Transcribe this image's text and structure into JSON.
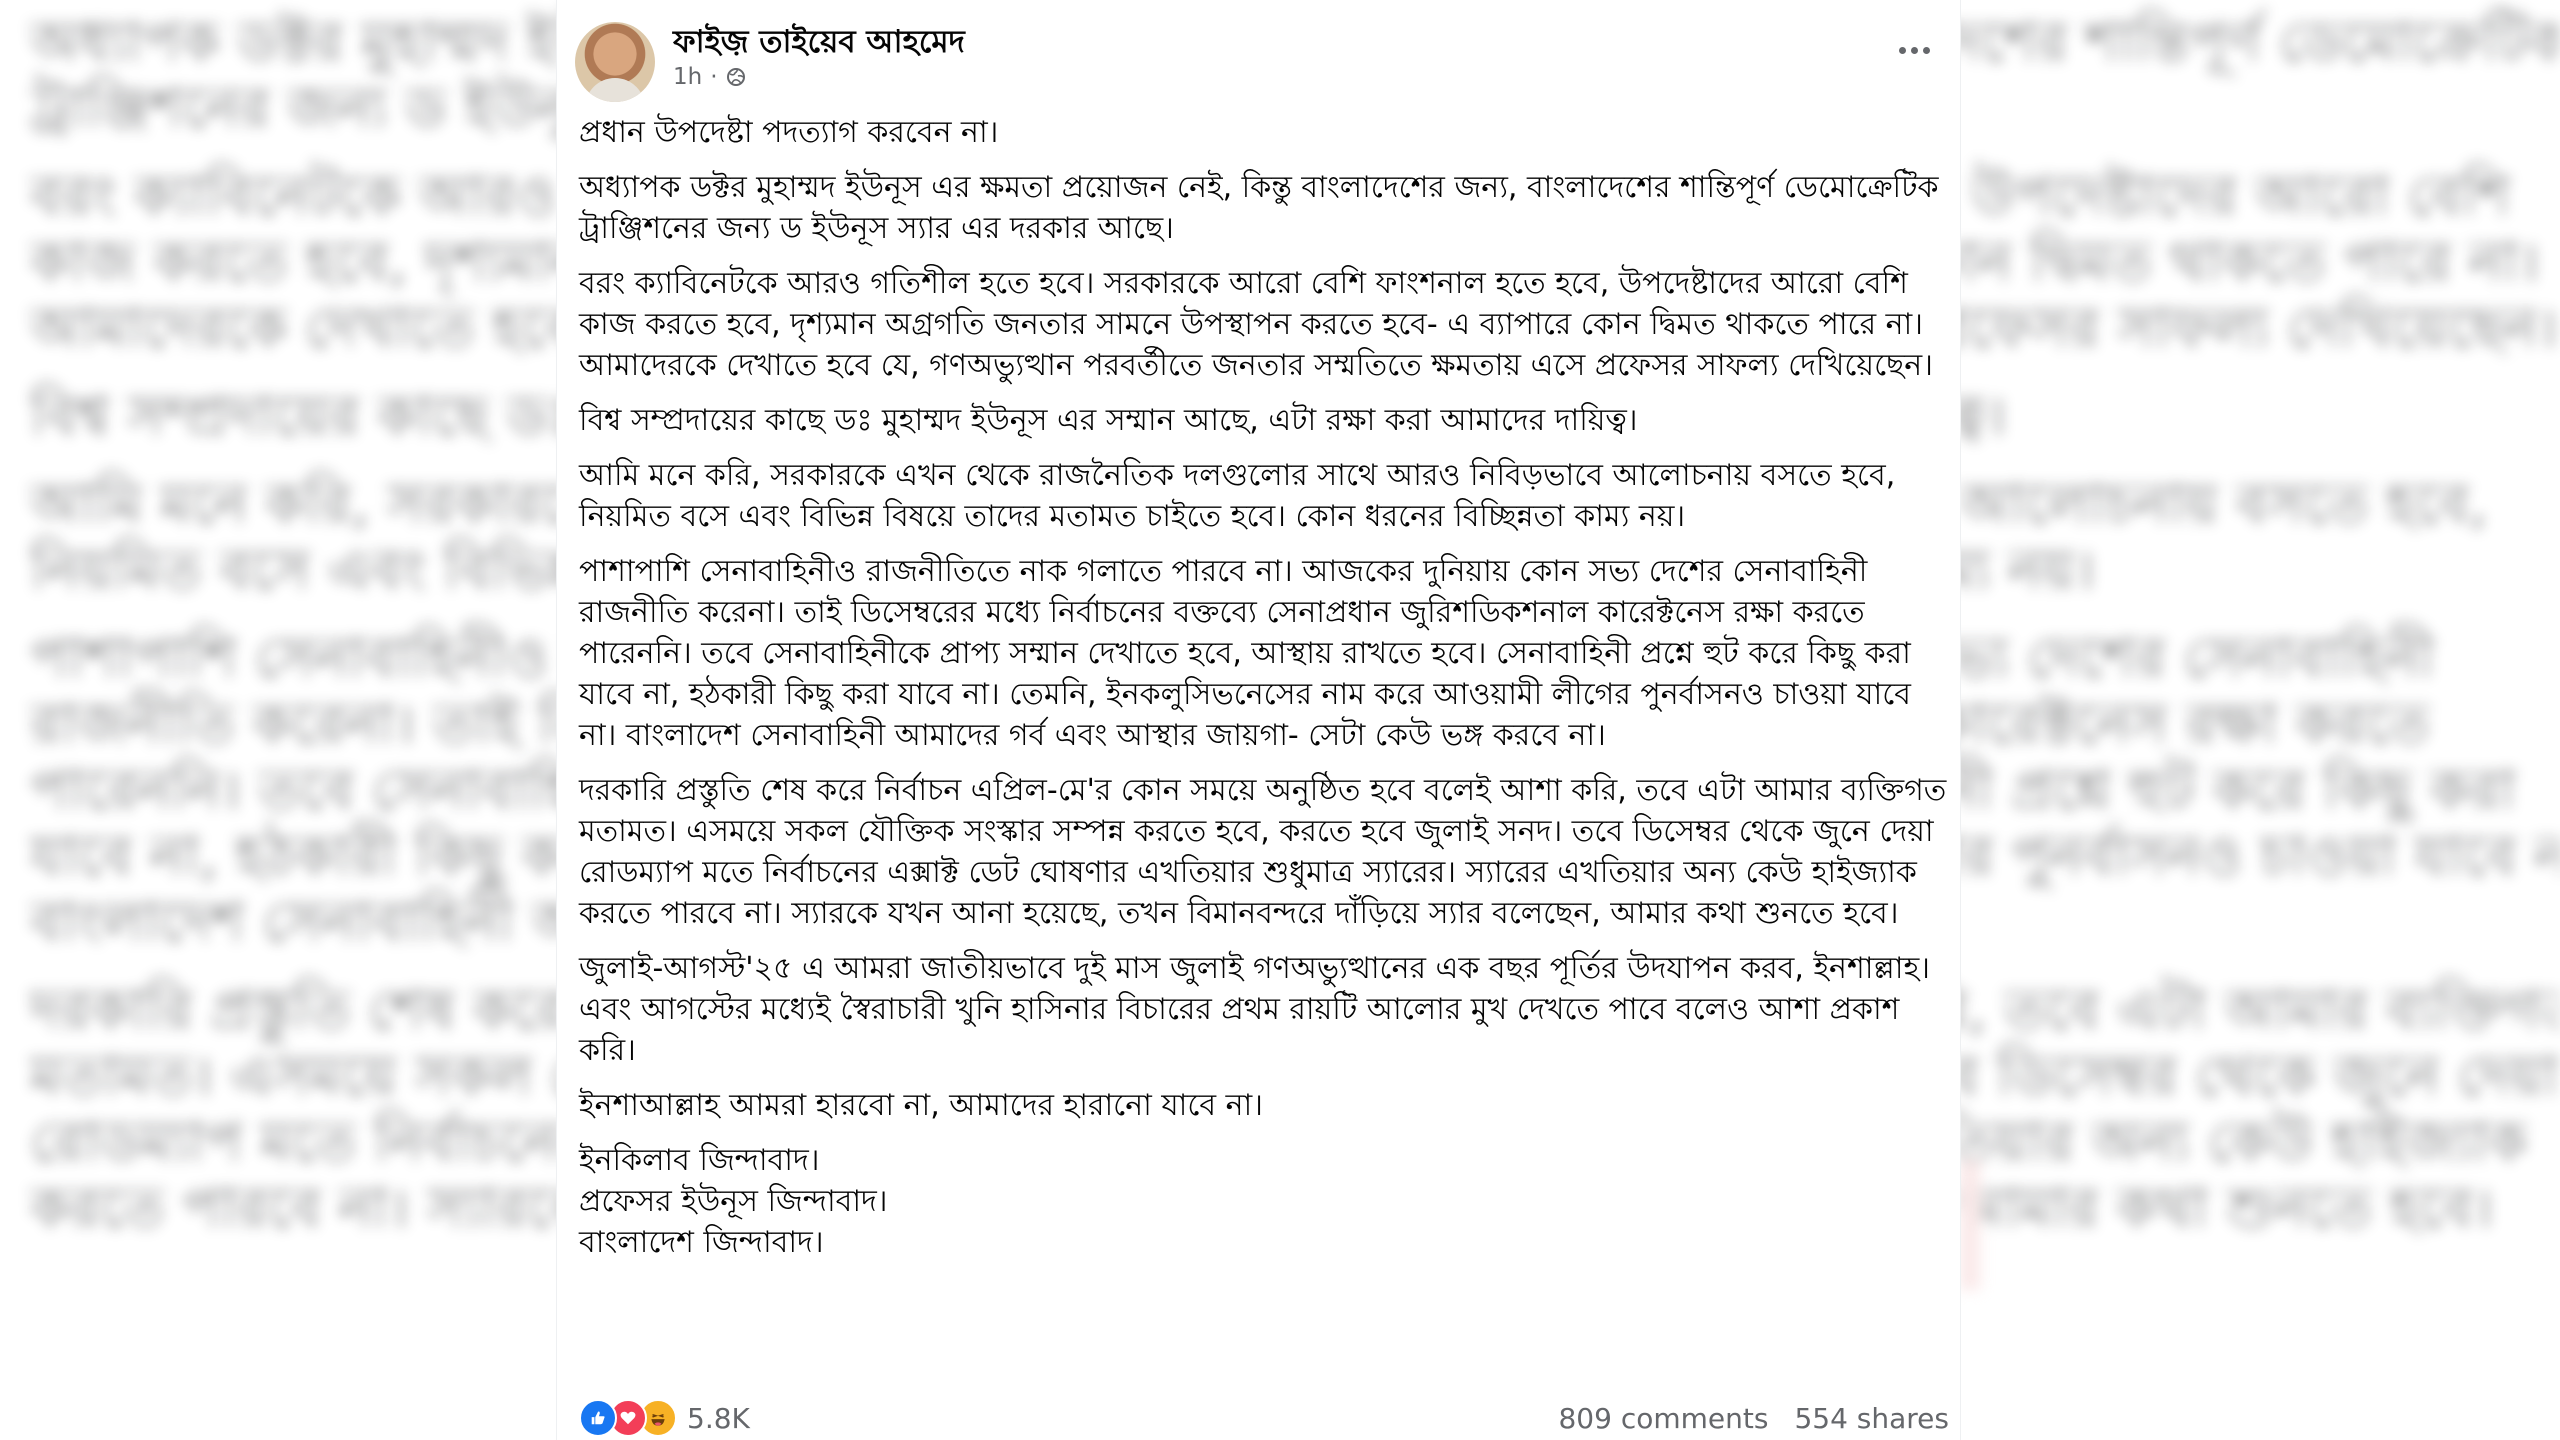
{
  "post": {
    "author": "ফাইজ় তাইয়েব আহমেদ",
    "time": "1h",
    "visibility_icon": "globe-icon",
    "menu_icon": "more-options-icon",
    "paragraphs": [
      "প্রধান উপদেষ্টা পদত্যাগ করবেন না।",
      "অধ্যাপক ডক্টর মুহাম্মদ ইউনূস এর ক্ষমতা প্রয়োজন নেই, কিন্তু বাংলাদেশের জন্য, বাংলাদেশের শান্তিপূর্ণ ডেমোক্রেটিক ট্রাঞ্জিশনের জন্য ড ইউনূস স্যার এর দরকার আছে।",
      "বরং ক্যাবিনেটকে আরও গতিশীল হতে হবে। সরকারকে আরো বেশি ফাংশনাল হতে হবে, উপদেষ্টাদের আরো বেশি কাজ করতে হবে, দৃশ্যমান অগ্রগতি জনতার সামনে উপস্থাপন করতে হবে- এ ব্যাপারে কোন দ্বিমত থাকতে পারে না। আমাদেরকে দেখাতে হবে যে, গণঅভ্যুত্থান পরবর্তীতে জনতার সম্মতিতে ক্ষমতায় এসে প্রফেসর সাফল্য দেখিয়েছেন।",
      "বিশ্ব সম্প্রদায়ের কাছে ডঃ মুহাম্মদ ইউনূস এর সম্মান আছে, এটা রক্ষা করা আমাদের দায়িত্ব।",
      "আমি মনে করি, সরকারকে এখন থেকে রাজনৈতিক দলগুলোর সাথে আরও নিবিড়ভাবে আলোচনায় বসতে হবে, নিয়মিত বসে এবং বিভিন্ন বিষয়ে তাদের মতামত চাইতে হবে। কোন ধরনের বিচ্ছিন্নতা কাম্য নয়।",
      "পাশাপাশি সেনাবাহিনীও রাজনীতিতে নাক গলাতে পারবে না। আজকের দুনিয়ায় কোন সভ্য দেশের সেনাবাহিনী রাজনীতি করেনা। তাই ডিসেম্বরের মধ্যে নির্বাচনের বক্তব্যে সেনাপ্রধান জুরিশডিকশনাল কারেক্টনেস রক্ষা করতে পারেননি। তবে সেনাবাহিনীকে প্রাপ্য সম্মান দেখাতে হবে, আস্থায় রাখতে হবে। সেনাবাহিনী প্রশ্নে হুট করে কিছু করা যাবে না, হঠকারী কিছু করা যাবে না। তেমনি, ইনকলুসিভনেসের নাম করে আওয়ামী লীগের পুনর্বাসনও চাওয়া যাবে না। বাংলাদেশ সেনাবাহিনী আমাদের গর্ব এবং আস্থার জায়গা- সেটা কেউ ভঙ্গ করবে না।",
      "দরকারি প্রস্তুতি শেষ করে নির্বাচন এপ্রিল-মে'র কোন সময়ে অনুষ্ঠিত হবে বলেই আশা করি, তবে এটা আমার ব্যক্তিগত মতামত। এসময়ে সকল যৌক্তিক সংস্কার সম্পন্ন করতে হবে, করতে হবে জুলাই সনদ। তবে ডিসেম্বর থেকে জুনে দেয়া রোডম্যাপ মতে নির্বাচনের এক্সাক্ট ডেট ঘোষণার এখতিয়ার শুধুমাত্র স্যারের। স্যারের এখতিয়ার অন্য কেউ হাইজ্যাক করতে পারবে না। স্যারকে যখন আনা হয়েছে, তখন বিমানবন্দরে দাঁড়িয়ে স্যার বলেছেন, আমার কথা শুনতে হবে।",
      "জুলাই-আগস্ট'২৫ এ আমরা জাতীয়ভাবে দুই মাস জুলাই গণঅভ্যুত্থানের এক বছর পূর্তির উদযাপন করব, ইনশাল্লাহ। এবং আগস্টের মধ্যেই স্বৈরাচারী খুনি হাসিনার বিচারের প্রথম রায়টি আলোর মুখ দেখতে পাবে বলেও আশা প্রকাশ করি।",
      "ইনশাআল্লাহ আমরা হারবো না, আমাদের হারানো যাবে না।",
      "ইনকিলাব জিন্দাবাদ।\nপ্রফেসর ইউনূস জিন্দাবাদ।\nবাংলাদেশ জিন্দাবাদ।"
    ]
  },
  "stats": {
    "reaction_icons": [
      "like-icon",
      "love-icon",
      "haha-icon"
    ],
    "reaction_count": "5.8K",
    "comments": "809 comments",
    "shares": "554 shares"
  },
  "colors": {
    "like": "#1877f2",
    "love": "#f33e58",
    "haha": "#f7b125",
    "secondary_text": "#65676b"
  }
}
